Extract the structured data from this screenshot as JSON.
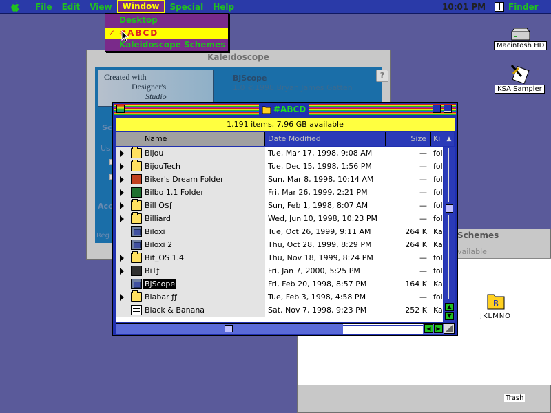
{
  "menubar": {
    "items": [
      "File",
      "Edit",
      "View",
      "Window",
      "Special",
      "Help"
    ],
    "open_menu": "Window",
    "clock": "10:01 PM",
    "app_name": "Finder"
  },
  "window_menu": {
    "items": [
      {
        "label": "Desktop",
        "checked": false,
        "selected": false
      },
      {
        "label": "#ABCD",
        "checked": true,
        "selected": true
      },
      {
        "label": "Kaleidoscope Schemes",
        "checked": false,
        "selected": false
      }
    ],
    "check_glyph": "✓"
  },
  "desktop": {
    "icons": [
      {
        "label": "Macintosh HD",
        "icon": "hard-disk-icon"
      },
      {
        "label": "KSA Sampler",
        "icon": "ksa-sampler-icon"
      }
    ]
  },
  "kaleidoscope_window": {
    "title": "Kaleidoscope",
    "logo_line1": "Created with",
    "logo_line2": "Designer's",
    "logo_line3": "Studio",
    "app_name": "BjScope",
    "version": "1.0 ©1998 Bryan James Gatten",
    "help": "?",
    "fragments": [
      "Sc",
      "Us",
      "Acc",
      "Reg"
    ]
  },
  "schemes_window": {
    "title": "Schemes",
    "subtitle": "vailable",
    "folder_label": "JKLMNO",
    "bottom_fragment": "Trash"
  },
  "finder_window": {
    "title": "#ABCD",
    "info": "1,191 items, 7.96 GB available",
    "columns": {
      "name": "Name",
      "date": "Date Modified",
      "size": "Size",
      "kind": "Ki"
    },
    "rows": [
      {
        "name": "Bijou",
        "date": "Tue, Mar 17, 1998, 9:08 AM",
        "size": "—",
        "kind": "fol",
        "icon": "folder",
        "expandable": true,
        "selected": false
      },
      {
        "name": "BijouTech",
        "date": "Tue, Dec 15, 1998, 1:56 PM",
        "size": "—",
        "kind": "fol",
        "icon": "folder",
        "expandable": true,
        "selected": false
      },
      {
        "name": "Biker's Dream Folder",
        "date": "Sun, Mar 8, 1998, 10:14 AM",
        "size": "—",
        "kind": "fol",
        "icon": "red",
        "expandable": true,
        "selected": false
      },
      {
        "name": "Bilbo 1.1 Folder",
        "date": "Fri, Mar 26, 1999, 2:21 PM",
        "size": "—",
        "kind": "fol",
        "icon": "green",
        "expandable": true,
        "selected": false
      },
      {
        "name": "Bill O$ƒ",
        "date": "Sun, Feb 1, 1998, 8:07 AM",
        "size": "—",
        "kind": "fol",
        "icon": "folder",
        "expandable": true,
        "selected": false
      },
      {
        "name": "Billiard",
        "date": "Wed, Jun 10, 1998, 10:23 PM",
        "size": "—",
        "kind": "fol",
        "icon": "folder",
        "expandable": true,
        "selected": false
      },
      {
        "name": "Biloxi",
        "date": "Tue, Oct 26, 1999, 9:11 AM",
        "size": "264 K",
        "kind": "Ka",
        "icon": "app",
        "expandable": false,
        "selected": false
      },
      {
        "name": "Biloxi 2",
        "date": "Thu, Oct 28, 1999, 8:29 PM",
        "size": "264 K",
        "kind": "Ka",
        "icon": "app",
        "expandable": false,
        "selected": false
      },
      {
        "name": "Bit_OS 1.4",
        "date": "Thu, Nov 18, 1999, 8:24 PM",
        "size": "—",
        "kind": "fol",
        "icon": "folder",
        "expandable": true,
        "selected": false
      },
      {
        "name": "BiTƒ",
        "date": "Fri, Jan 7, 2000, 5:25 PM",
        "size": "—",
        "kind": "fol",
        "icon": "dark",
        "expandable": true,
        "selected": false
      },
      {
        "name": "BjScope",
        "date": "Fri, Feb 20, 1998, 8:57 PM",
        "size": "164 K",
        "kind": "Ka",
        "icon": "app",
        "expandable": false,
        "selected": true
      },
      {
        "name": "Blabar ƒƒ",
        "date": "Tue, Feb 3, 1998, 4:58 PM",
        "size": "—",
        "kind": "fol",
        "icon": "folder",
        "expandable": true,
        "selected": false
      },
      {
        "name": "Black & Banana",
        "date": "Sat, Nov 7, 1998, 9:23 PM",
        "size": "252 K",
        "kind": "Ka",
        "icon": "doc",
        "expandable": false,
        "selected": false
      }
    ]
  },
  "colors": {
    "desktop": "#5a5a9a",
    "menubar": "#2a3aa8",
    "menu_text": "#20c020",
    "menu_highlight": "#ffff00",
    "menu_bg": "#7a2a8a",
    "window_frame": "#2030b0",
    "info_bar": "#ffff40"
  }
}
